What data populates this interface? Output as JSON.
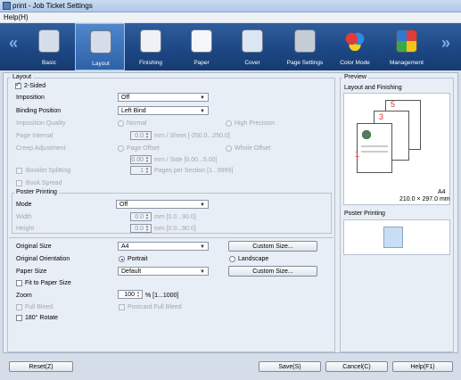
{
  "window": {
    "title": "print - Job Ticket Settings"
  },
  "menu": {
    "help": "Help(H)"
  },
  "toolbar": {
    "items": [
      {
        "label": "Basic"
      },
      {
        "label": "Layout"
      },
      {
        "label": "Finishing"
      },
      {
        "label": "Paper"
      },
      {
        "label": "Cover"
      },
      {
        "label": "Page Settings"
      },
      {
        "label": "Color Mode"
      },
      {
        "label": "Management"
      }
    ],
    "selected": "Layout"
  },
  "layout": {
    "group_title": "Layout",
    "two_sided": {
      "label": "2-Sided",
      "checked": true
    },
    "imposition": {
      "label": "Imposition",
      "value": "Off"
    },
    "binding_position": {
      "label": "Binding Position",
      "value": "Left Bind"
    },
    "imposition_quality": {
      "label": "Imposition Quality",
      "normal": "Normal",
      "high": "High Precision"
    },
    "page_interval": {
      "label": "Page Interval",
      "value": "0.0",
      "unit": "mm / Sheet [-250.0...250.0]"
    },
    "creep_adjustment": {
      "label": "Creep Adjustment",
      "page_offset": "Page Offset",
      "whole_offset": "Whole Offset",
      "value": "0.00",
      "unit": "mm / Side [0.00...5.00]"
    },
    "booklet_splitting": {
      "label": "Booklet Splitting",
      "value": "1",
      "unit": "Pages per Section [1...9999]"
    },
    "book_spread": {
      "label": "Book Spread"
    },
    "poster_printing": {
      "title": "Poster Printing",
      "mode": {
        "label": "Mode",
        "value": "Off"
      },
      "width": {
        "label": "Width",
        "value": "0.0",
        "unit": "mm [0.0...90.0]"
      },
      "height": {
        "label": "Height",
        "value": "0.0",
        "unit": "mm [0.0...90.0]"
      }
    },
    "original_size": {
      "label": "Original Size",
      "value": "A4",
      "button": "Custom Size..."
    },
    "original_orientation": {
      "label": "Original Orientation",
      "portrait": "Portrait",
      "landscape": "Landscape"
    },
    "paper_size": {
      "label": "Paper Size",
      "value": "Default",
      "button": "Custom Size..."
    },
    "fit_to_paper": {
      "label": "Fit to Paper Size"
    },
    "zoom": {
      "label": "Zoom",
      "value": "100",
      "unit": "% [1...1000]"
    },
    "full_bleed": {
      "label": "Full Bleed"
    },
    "postcard_full_bleed": {
      "label": "Postcard Full Bleed"
    },
    "rotate": {
      "label": "180°  Rotate"
    }
  },
  "preview": {
    "group_title": "Preview",
    "layout_title": "Layout and Finishing",
    "paper": "A4",
    "paper_dims": "210.0 × 297.0 mm",
    "pages": [
      "1",
      "3",
      "5"
    ],
    "poster_title": "Poster Printing"
  },
  "footer": {
    "reset": "Reset(Z)",
    "save": "Save(S)",
    "cancel": "Cancel(C)",
    "help": "Help(F1)"
  }
}
